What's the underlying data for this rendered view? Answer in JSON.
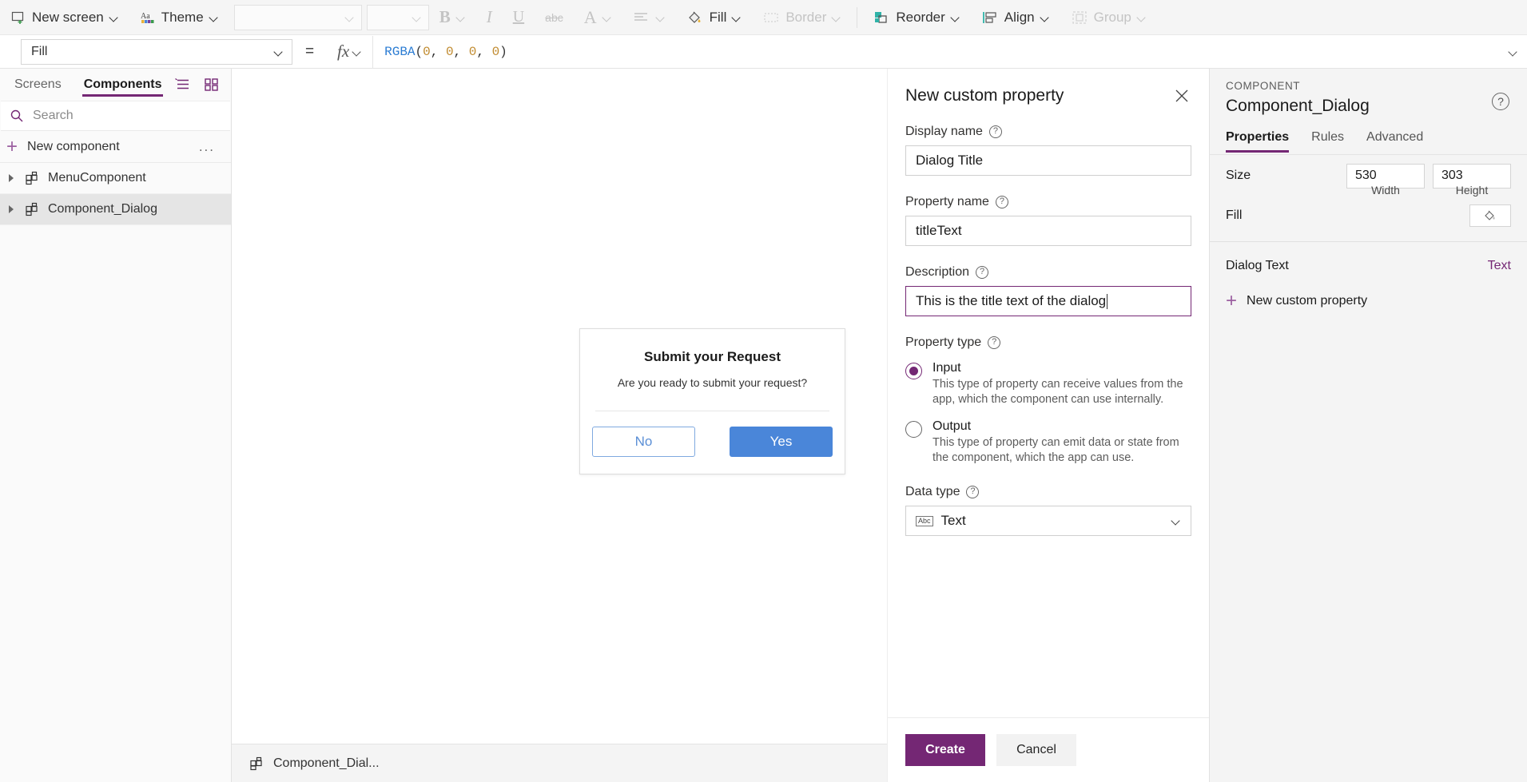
{
  "toolbar": {
    "new_screen": "New screen",
    "theme": "Theme",
    "font_family_value": "",
    "font_size_value": "",
    "bold": "B",
    "italic": "I",
    "underline": "U",
    "strikethrough": "abc",
    "font_color": "A",
    "align": "align-icon",
    "fill": "Fill",
    "border": "Border",
    "reorder": "Reorder",
    "align_menu": "Align",
    "group": "Group"
  },
  "formula_bar": {
    "property": "Fill",
    "equals": "=",
    "fx": "fx",
    "formula_fn": "RGBA",
    "formula_args": [
      "0",
      "0",
      "0",
      "0"
    ],
    "formula_full": "RGBA(0, 0, 0, 0)"
  },
  "left_panel": {
    "tabs": [
      {
        "label": "Screens",
        "active": false
      },
      {
        "label": "Components",
        "active": true
      }
    ],
    "search_placeholder": "Search",
    "new_component": "New component",
    "more_options": "...",
    "items": [
      {
        "label": "MenuComponent",
        "selected": false
      },
      {
        "label": "Component_Dialog",
        "selected": true
      }
    ]
  },
  "canvas": {
    "preview": {
      "title": "Submit your Request",
      "subtitle": "Are you ready to submit your request?",
      "button_no": "No",
      "button_yes": "Yes",
      "color_primary": "#4a86d9",
      "color_ghost_text": "#5b8fd6"
    },
    "status_label": "Component_Dial..."
  },
  "new_property_panel": {
    "title": "New custom property",
    "close": "✕",
    "display_name": {
      "label": "Display name",
      "value": "Dialog Title"
    },
    "property_name": {
      "label": "Property name",
      "value": "titleText"
    },
    "description": {
      "label": "Description",
      "value": "This is the title text of the dialog"
    },
    "property_type": {
      "label": "Property type",
      "options": [
        {
          "title": "Input",
          "desc": "This type of property can receive values from the app, which the component can use internally.",
          "selected": true
        },
        {
          "title": "Output",
          "desc": "This type of property can emit data or state from the component, which the app can use.",
          "selected": false
        }
      ]
    },
    "data_type": {
      "label": "Data type",
      "value": "Text",
      "icon": "Abc"
    },
    "create_button": "Create",
    "cancel_button": "Cancel",
    "accent": "#742774"
  },
  "right_pane": {
    "kicker": "COMPONENT",
    "name": "Component_Dialog",
    "tabs": [
      {
        "label": "Properties",
        "active": true
      },
      {
        "label": "Rules",
        "active": false
      },
      {
        "label": "Advanced",
        "active": false
      }
    ],
    "size": {
      "label": "Size",
      "width_value": "530",
      "height_value": "303",
      "width_label": "Width",
      "height_label": "Height"
    },
    "fill": {
      "label": "Fill"
    },
    "custom_properties": [
      {
        "name": "Dialog Text",
        "type": "Text"
      }
    ],
    "new_custom_property": "New custom property"
  }
}
